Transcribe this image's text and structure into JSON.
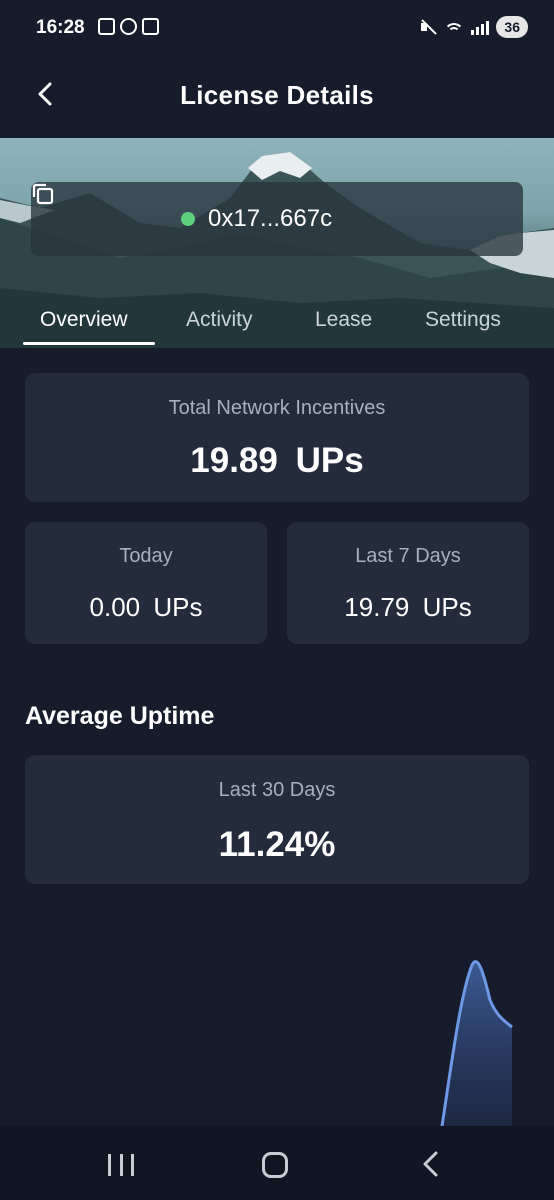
{
  "status_bar": {
    "time": "16:28",
    "left_icons": [
      "screenshot-icon",
      "whatsapp-icon",
      "news-icon"
    ],
    "right_icons": [
      "mute-icon",
      "wifi-icon",
      "signal-icon"
    ],
    "battery": "36"
  },
  "header": {
    "back_icon": "chevron-left-icon",
    "title": "License Details"
  },
  "license": {
    "status_color": "#5fd07e",
    "address": "0x17...667c",
    "copy_icon": "copy-icon"
  },
  "tabs": [
    {
      "label": "Overview",
      "active": true
    },
    {
      "label": "Activity",
      "active": false
    },
    {
      "label": "Lease",
      "active": false
    },
    {
      "label": "Settings",
      "active": false
    }
  ],
  "incentives": {
    "total": {
      "label": "Total Network Incentives",
      "value": "19.89",
      "unit": "UPs"
    },
    "today": {
      "label": "Today",
      "value": "0.00",
      "unit": "UPs"
    },
    "last7": {
      "label": "Last 7 Days",
      "value": "19.79",
      "unit": "UPs"
    }
  },
  "uptime": {
    "section_title": "Average Uptime",
    "label": "Last 30 Days",
    "value": "11.24%"
  },
  "nav_bar": {
    "icons": [
      "recents-icon",
      "home-icon",
      "back-icon"
    ]
  },
  "colors": {
    "background": "#161c2b",
    "card": "#232b3c",
    "accent_line": "#6f98e6",
    "online_dot": "#5fd07e"
  }
}
